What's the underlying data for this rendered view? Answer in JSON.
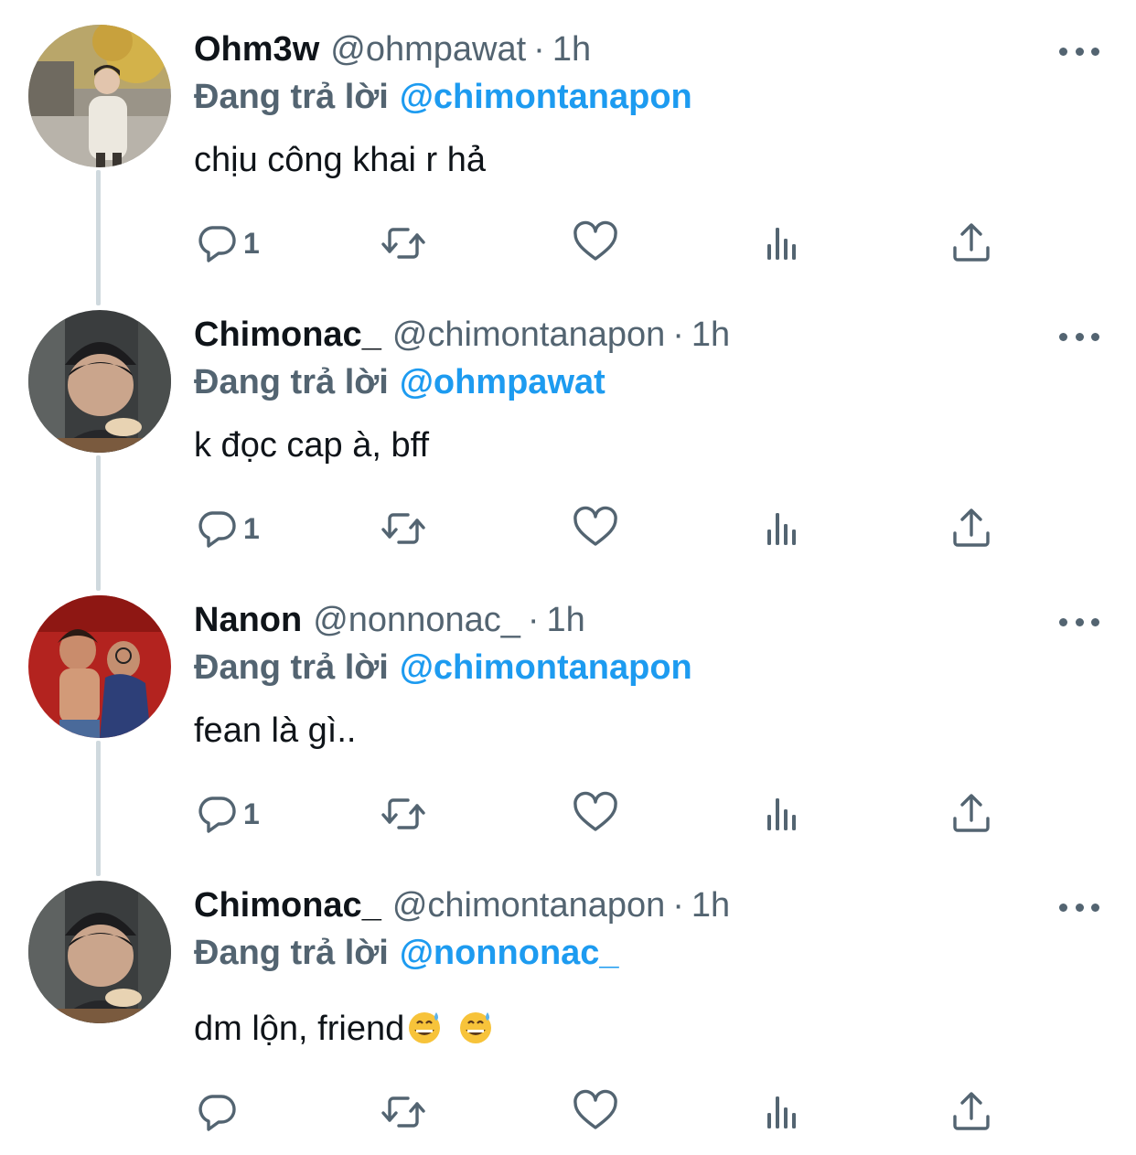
{
  "tweets": [
    {
      "name": "Ohm3w",
      "handle": "@ohmpawat",
      "separator": "·",
      "time": "1h",
      "replying_prefix": "Đang trả lời",
      "replying_to": "@chimontanapon",
      "text": "chịu công khai r hả",
      "reply_count": "1"
    },
    {
      "name": "Chimonac_",
      "handle": "@chimontanapon",
      "separator": "·",
      "time": "1h",
      "replying_prefix": "Đang trả lời",
      "replying_to": "@ohmpawat",
      "text": "k đọc cap à, bff",
      "reply_count": "1"
    },
    {
      "name": "Nanon",
      "handle": "@nonnonac_",
      "separator": "·",
      "time": "1h",
      "replying_prefix": "Đang trả lời",
      "replying_to": "@chimontanapon",
      "text": "fean là gì..",
      "reply_count": "1"
    },
    {
      "name": "Chimonac_",
      "handle": "@chimontanapon",
      "separator": "·",
      "time": "1h",
      "replying_prefix": "Đang trả lời",
      "replying_to": "@nonnonac_",
      "text": "dm lộn, friend",
      "reply_count": ""
    }
  ],
  "icons": {
    "reply": "reply-icon",
    "retweet": "retweet-icon",
    "like": "like-icon",
    "views": "views-icon",
    "share": "share-icon",
    "more": "more-icon",
    "emoji": "grinning-sweat-emoji"
  },
  "colors": {
    "accent": "#1d9bf0",
    "secondary_text": "#536471",
    "primary_text": "#0f1419",
    "thread_line": "#cfd9de"
  }
}
